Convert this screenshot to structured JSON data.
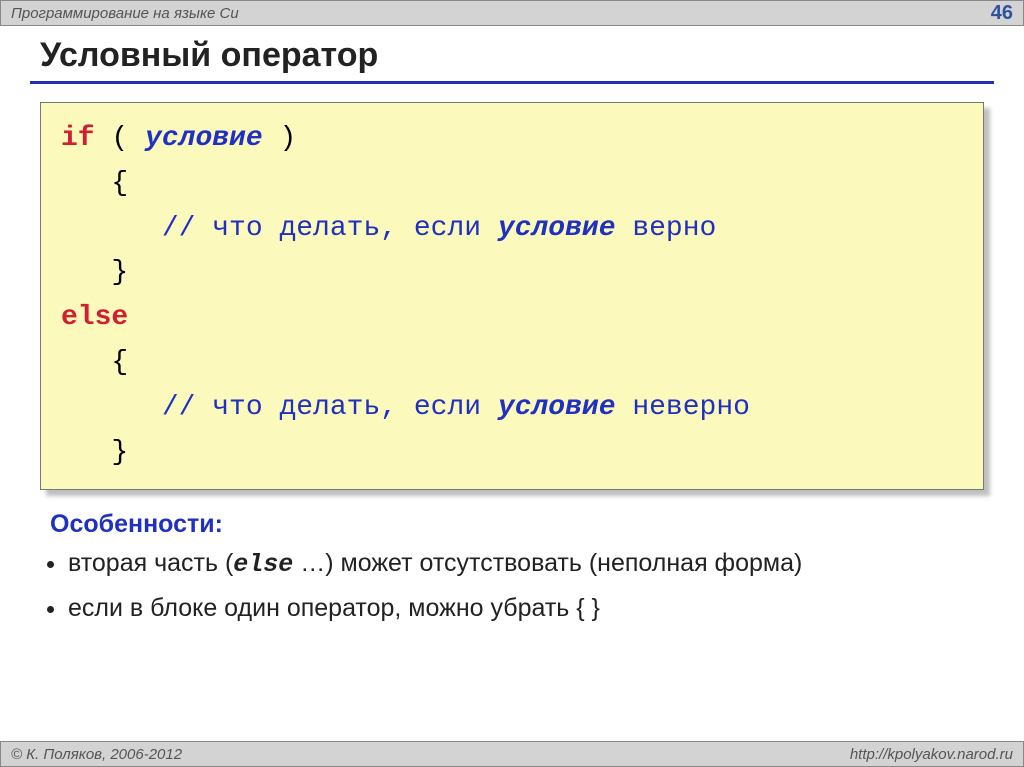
{
  "header": {
    "subject": "Программирование на языке Си",
    "page": "46"
  },
  "title": "Условный оператор",
  "code": {
    "line1_if": "if",
    "line1_open": " ( ",
    "line1_cond": "условие",
    "line1_close": " )",
    "line2": "   {",
    "line3_indent": "      ",
    "line3_comment_a": "// что делать, если ",
    "line3_cond": "условие",
    "line3_comment_b": " верно",
    "line4": "   }",
    "line5_else": "else",
    "line6": "   {",
    "line7_indent": "      ",
    "line7_comment_a": "// что делать, если ",
    "line7_cond": "условие",
    "line7_comment_b": " неверно",
    "line8": "   }"
  },
  "features": {
    "title": "Особенности:",
    "bullet1_a": "вторая часть (",
    "bullet1_else": "else",
    "bullet1_b": " …) может отсутствовать (неполная форма)",
    "bullet2": "если в блоке один оператор, можно убрать { }"
  },
  "footer": {
    "copyright": "© К. Поляков, 2006-2012",
    "url": "http://kpolyakov.narod.ru"
  }
}
